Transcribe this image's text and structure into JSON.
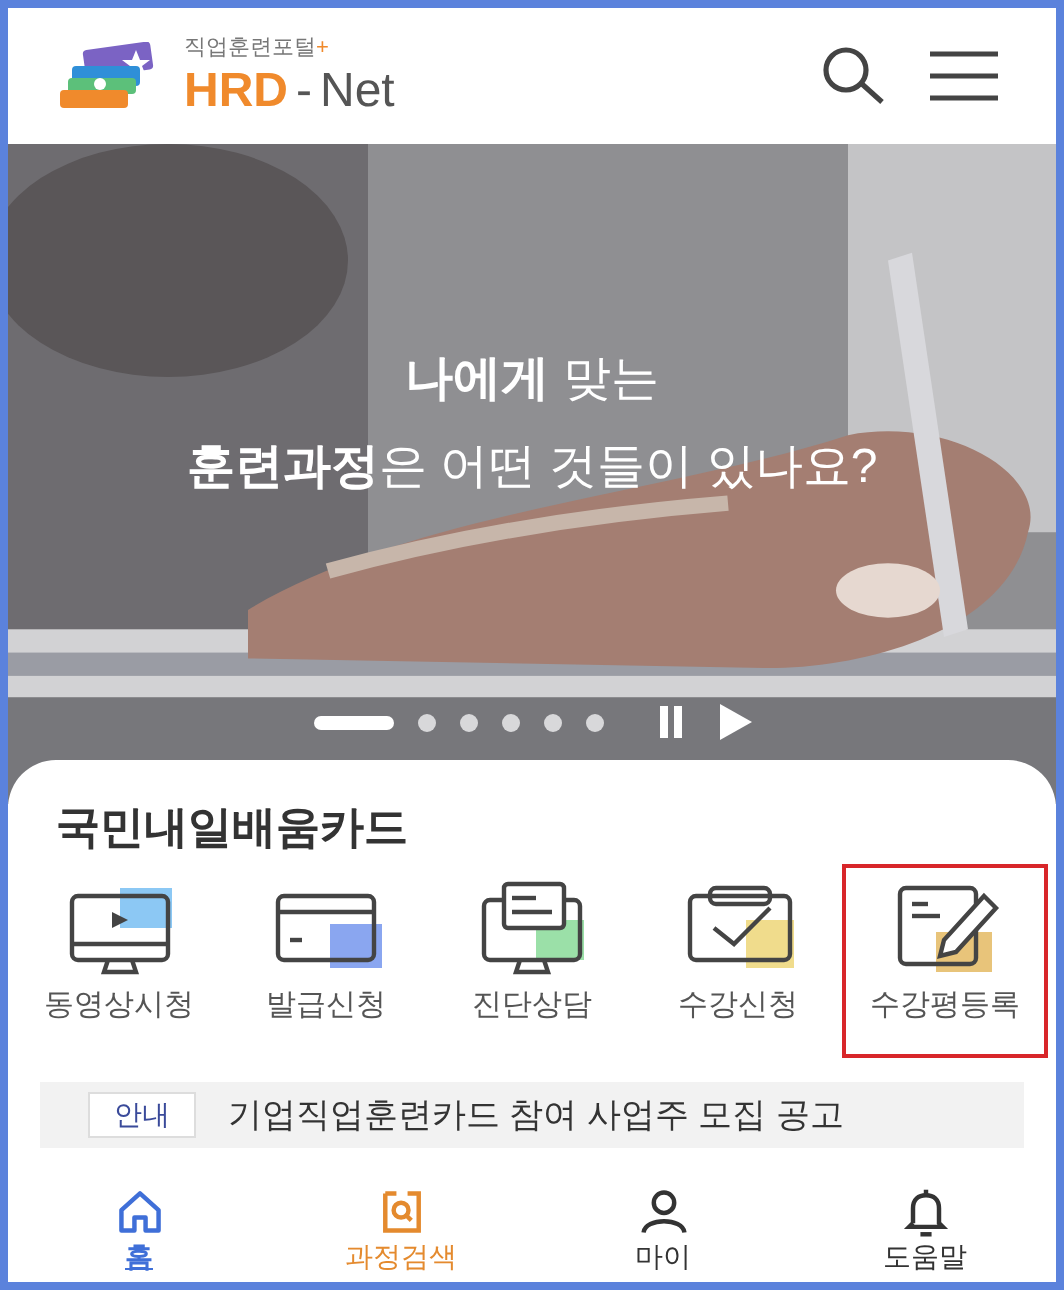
{
  "header": {
    "logo_caption": "직업훈련포털",
    "logo_plus": "+",
    "logo_brand": "HRD",
    "logo_dash": "-",
    "logo_suffix": "Net"
  },
  "hero": {
    "kind": "picture",
    "headline": [
      "**나에게** 맞는",
      "**훈련과정**은 어떤 것들이 있나요?"
    ],
    "slides": [
      {
        "selected": true
      },
      {
        "selected": false
      },
      {
        "selected": false
      },
      {
        "selected": false
      },
      {
        "selected": false
      },
      {
        "selected": false
      }
    ],
    "paused": false
  },
  "card": {
    "title": "국민내일배움카드",
    "menu": [
      {
        "kind": "video",
        "label": "동영상시청",
        "color": "#8cc8f4",
        "highlighted": false
      },
      {
        "kind": "card",
        "label": "발급신청",
        "color": "#8aa6f0",
        "highlighted": false
      },
      {
        "kind": "consult",
        "label": "진단상담",
        "color": "#9be0a8",
        "highlighted": false
      },
      {
        "kind": "apply",
        "label": "수강신청",
        "color": "#f0dc8c",
        "highlighted": false
      },
      {
        "kind": "review",
        "label": "수강평등록",
        "color": "#e8c47a",
        "highlighted": true
      }
    ],
    "notice": {
      "badge": "안내",
      "text": "기업직업훈련카드 참여 사업주 모집 공고"
    }
  },
  "bottom_nav": [
    {
      "kind": "home",
      "label": "홈",
      "selected": true,
      "color": "#3f6fd8"
    },
    {
      "kind": "search",
      "label": "과정검색",
      "selected": false,
      "color": "#e48a2e"
    },
    {
      "kind": "my",
      "label": "마이",
      "selected": false,
      "color": "#333333"
    },
    {
      "kind": "help",
      "label": "도움말",
      "selected": false,
      "color": "#333333"
    }
  ]
}
